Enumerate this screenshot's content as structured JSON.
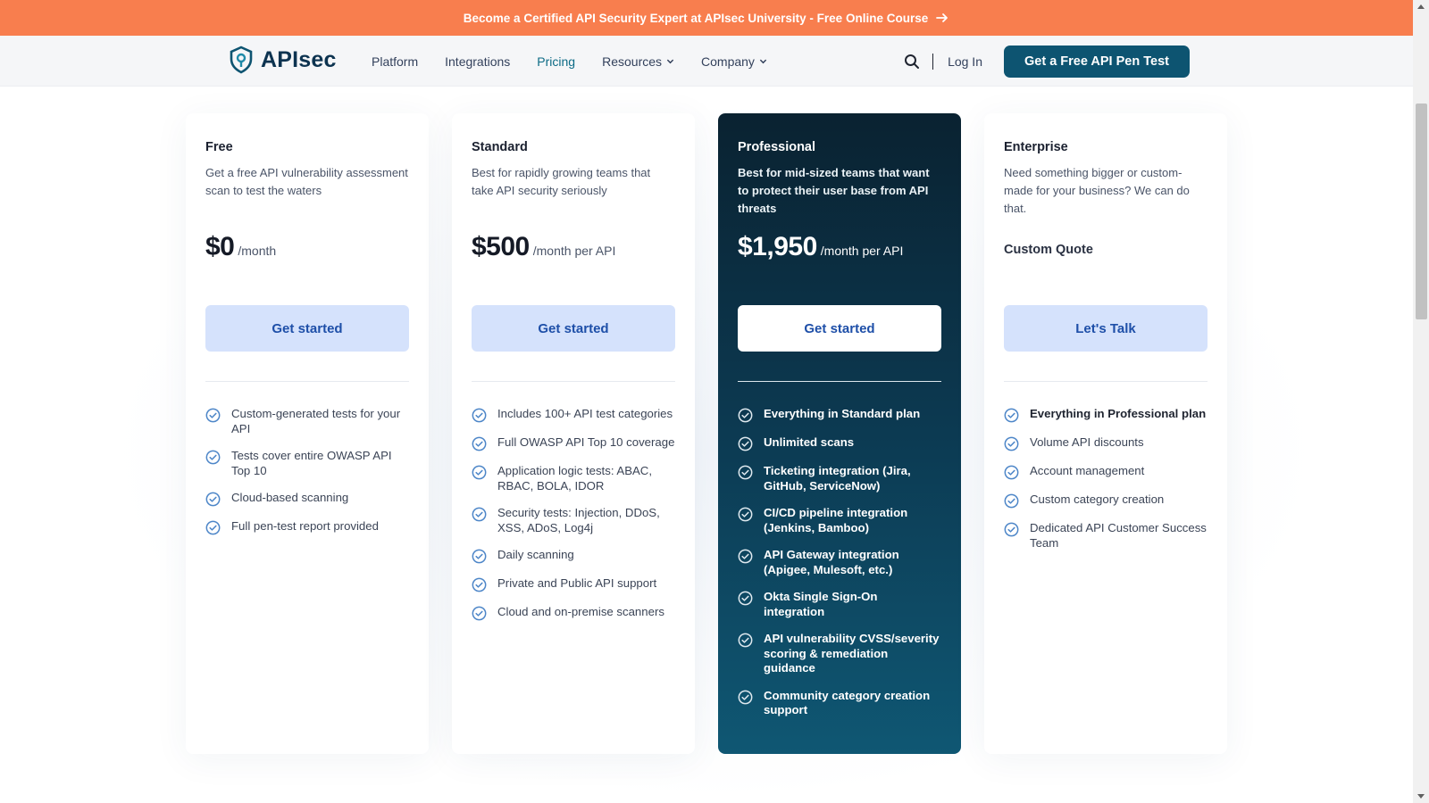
{
  "promo": {
    "text": "Become a Certified API Security Expert at APIsec University - Free Online Course"
  },
  "nav": {
    "logo_text": "APIsec",
    "items": [
      {
        "label": "Platform",
        "dropdown": false,
        "active": false
      },
      {
        "label": "Integrations",
        "dropdown": false,
        "active": false
      },
      {
        "label": "Pricing",
        "dropdown": false,
        "active": true
      },
      {
        "label": "Resources",
        "dropdown": true,
        "active": false
      },
      {
        "label": "Company",
        "dropdown": true,
        "active": false
      }
    ],
    "login_label": "Log In",
    "cta_label": "Get a Free API Pen Test"
  },
  "colors": {
    "promo": "#f87e4e",
    "brand": "#0d5471",
    "button_bg": "#d5e2fc",
    "button_text": "#1e4fa8",
    "check": "#4d86c8"
  },
  "plans": [
    {
      "name": "Free",
      "description": "Get a free API vulnerability assessment scan to test the waters",
      "price": "$0",
      "period": "/month",
      "button": "Get started",
      "features": [
        "Custom-generated tests for your API",
        "Tests cover entire OWASP API Top 10",
        "Cloud-based scanning",
        "Full pen-test report provided"
      ]
    },
    {
      "name": "Standard",
      "description": "Best for rapidly growing teams that take API security seriously",
      "price": "$500",
      "period": "/month per API",
      "button": "Get started",
      "features": [
        "Includes 100+ API test categories",
        "Full OWASP API Top 10 coverage",
        "Application logic tests: ABAC, RBAC, BOLA, IDOR",
        "Security tests: Injection, DDoS, XSS, ADoS, Log4j",
        "Daily scanning",
        "Private and Public API support",
        "Cloud and on-premise scanners"
      ]
    },
    {
      "name": "Professional",
      "description": "Best for mid-sized teams that want to protect their user base from API threats",
      "price": "$1,950",
      "period": "/month per API",
      "button": "Get started",
      "features": [
        "Everything in Standard plan",
        "Unlimited scans",
        "Ticketing integration (Jira, GitHub, ServiceNow)",
        "CI/CD pipeline integration (Jenkins, Bamboo)",
        "API Gateway integration (Apigee, Mulesoft, etc.)",
        "Okta Single Sign-On integration",
        "API vulnerability CVSS/severity scoring & remediation guidance",
        "Community category creation support"
      ]
    },
    {
      "name": "Enterprise",
      "description": "Need something bigger or custom-made for your business? We can do that.",
      "custom_quote": "Custom Quote",
      "button": "Let's Talk",
      "features": [
        "Everything in Professional plan",
        "Volume API discounts",
        "Account management",
        "Custom category creation",
        "Dedicated API Customer Success Team"
      ]
    }
  ]
}
